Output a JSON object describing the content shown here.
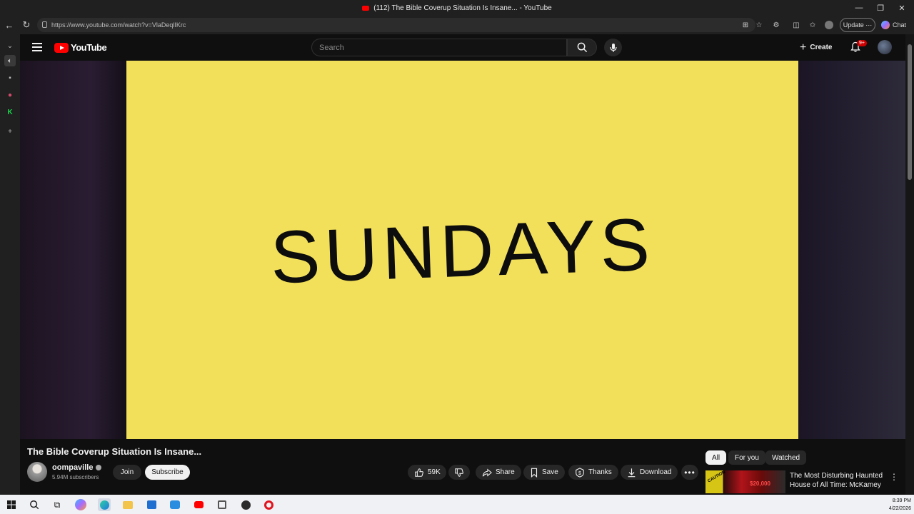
{
  "window": {
    "title": "(112) The Bible Coverup Situation Is Insane... - YouTube",
    "minimize": "—",
    "restore": "❐",
    "close": "✕"
  },
  "browser": {
    "url": "https://www.youtube.com/watch?v=VlaDeqlIKrc",
    "update_label": "Update",
    "chat_label": "Chat"
  },
  "youtube": {
    "logo_text": "YouTube",
    "search_placeholder": "Search",
    "create_label": "Create",
    "notification_badge": "9+"
  },
  "video": {
    "frame_text": "SUNDAYS",
    "frame_color": "#f2e05a",
    "title": "The Bible Coverup Situation Is Insane...",
    "channel_name": "oompaville",
    "subscribers": "5.94M subscribers",
    "join_label": "Join",
    "subscribe_label": "Subscribe",
    "like_count": "59K",
    "share_label": "Share",
    "save_label": "Save",
    "thanks_label": "Thanks",
    "download_label": "Download"
  },
  "related": {
    "chips": [
      "All",
      "For you",
      "Watched"
    ],
    "active_chip": "All",
    "item": {
      "title": "The Most Disturbing Haunted House of All Time: McKamey ...",
      "thumb_caution": "CAUTION",
      "thumb_money": "$20,000"
    }
  },
  "taskbar": {
    "time": "8:39 PM",
    "date": "4/22/2026"
  },
  "colors": {
    "accent": "#ff0000",
    "background": "#0f0f0f"
  }
}
